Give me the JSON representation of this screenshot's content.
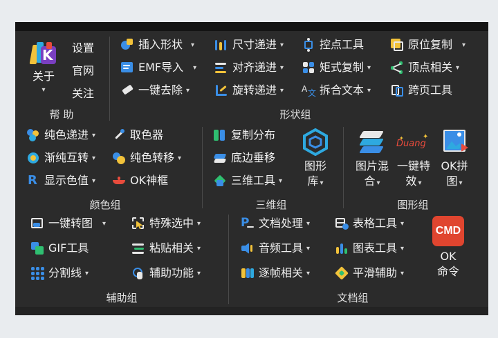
{
  "help_group": {
    "about": "关于",
    "settings": "设置",
    "website": "官网",
    "follow": "关注",
    "group_label": "帮 助"
  },
  "shape_group": {
    "insert_shape": "插入形状",
    "size_step": "尺寸递进",
    "control_tool": "控点工具",
    "copy_in_place": "原位复制",
    "emf_import": "EMF导入",
    "align_step": "对齐递进",
    "matrix_copy": "矩式复制",
    "vertex_related": "顶点相关",
    "one_key_remove": "一键去除",
    "rotate_step": "旋转递进",
    "split_text": "拆合文本",
    "cross_page_tool": "跨页工具",
    "group_label": "形状组"
  },
  "color_group": {
    "solid_step": "纯色递进",
    "picker": "取色器",
    "gradient_solid": "渐纯互转",
    "solid_transfer": "纯色转移",
    "show_color": "显示色值",
    "ok_lamp": "OK神框",
    "group_label": "颜色组"
  },
  "three_d_group": {
    "copy_distribute": "复制分布",
    "bottom_move": "底边垂移",
    "three_d_tool": "三维工具",
    "shape_lib_line1": "图形",
    "shape_lib_line2": "库",
    "group_label": "三维组"
  },
  "graphics_group": {
    "image_mix_line1": "图片混",
    "image_mix_line2": "合",
    "one_key_effect_line1": "一键特",
    "one_key_effect_line2": "效",
    "duang_text": "Duang",
    "ok_stitch_line1": "OK拼",
    "ok_stitch_line2": "图",
    "group_label": "图形组"
  },
  "assist_group": {
    "one_key_to_image": "一键转图",
    "special_select": "特殊选中",
    "gif_tool": "GIF工具",
    "paste_related": "粘贴相关",
    "divider_line": "分割线",
    "aux_function": "辅助功能",
    "group_label": "辅助组"
  },
  "doc_group": {
    "doc_process": "文档处理",
    "table_tool": "表格工具",
    "audio_tool": "音频工具",
    "chart_tool": "图表工具",
    "frame_related": "逐帧相关",
    "smooth_assist": "平滑辅助",
    "cmd_text": "CMD",
    "ok_command_line1": "OK",
    "ok_command_line2": "命令",
    "group_label": "文档组"
  },
  "dropdown_glyph": "▾",
  "colors": {
    "panel_bg": "#2b2b2b",
    "top_bar": "#141414",
    "text": "#f0f0f0",
    "cmd_red": "#e0452f",
    "accent_blue": "#3a8ee6",
    "accent_yellow": "#f2c23a"
  }
}
